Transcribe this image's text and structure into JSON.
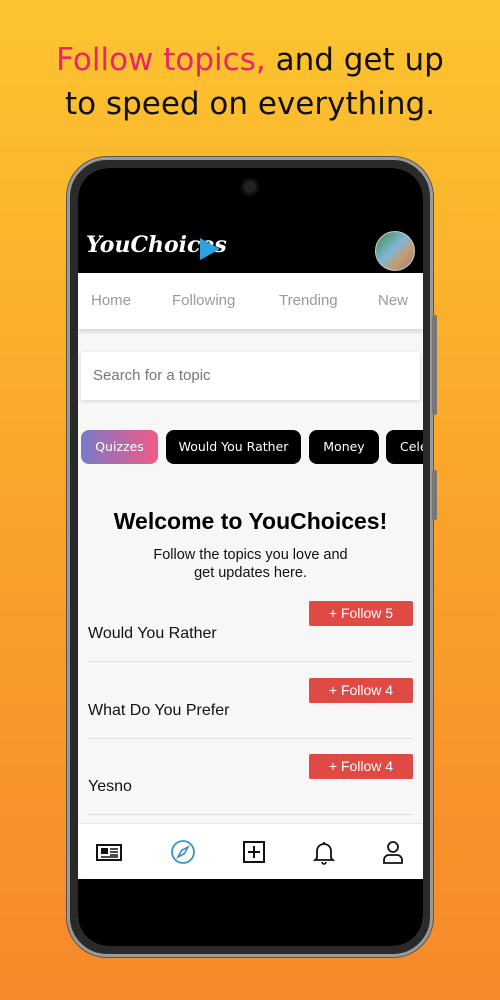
{
  "headline": {
    "highlight": "Follow topics,",
    "rest_line1": " and get up",
    "line2": "to speed on everything."
  },
  "app": {
    "logo_text": "YouChoices",
    "accent": "#2aa3e0"
  },
  "tabs": [
    {
      "label": "Home"
    },
    {
      "label": "Following"
    },
    {
      "label": "Trending"
    },
    {
      "label": "New"
    }
  ],
  "search": {
    "placeholder": "Search for a topic"
  },
  "chips": [
    {
      "label": "Quizzes",
      "active": true
    },
    {
      "label": "Would You Rather"
    },
    {
      "label": "Money"
    },
    {
      "label": "Cele"
    }
  ],
  "welcome": {
    "title": "Welcome to YouChoices!",
    "subtitle_line1": "Follow the topics you love and",
    "subtitle_line2": "get updates here."
  },
  "topics": [
    {
      "name": "Would You Rather",
      "button": "+ Follow 5"
    },
    {
      "name": "What Do You Prefer",
      "button": "+ Follow 4"
    },
    {
      "name": "Yesno",
      "button": "+ Follow 4"
    }
  ],
  "nav": [
    {
      "icon": "newspaper-icon"
    },
    {
      "icon": "compass-icon",
      "active": true
    },
    {
      "icon": "add-square-icon"
    },
    {
      "icon": "bell-icon"
    },
    {
      "icon": "user-icon"
    }
  ],
  "colors": {
    "follow_button": "#e04a45",
    "headline_pink": "#e8266a",
    "background": "#fcc430"
  }
}
